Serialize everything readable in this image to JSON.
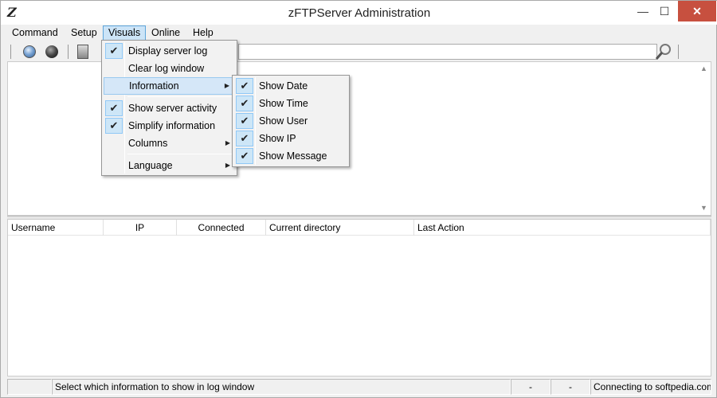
{
  "window": {
    "title": "zFTPServer Administration",
    "app_icon_glyph": "Z"
  },
  "titlebar_buttons": {
    "minimize": "—",
    "maximize": "☐",
    "close": "✕"
  },
  "menubar": {
    "command": "Command",
    "setup": "Setup",
    "visuals": "Visuals",
    "online": "Online",
    "help": "Help"
  },
  "toolbar": {
    "search_icon": "magnifier-icon"
  },
  "visuals_menu": {
    "display_server_log": "Display server log",
    "clear_log_window": "Clear log window",
    "information": "Information",
    "show_server_activity": "Show server activity",
    "simplify_information": "Simplify information",
    "columns": "Columns",
    "language": "Language",
    "checked": {
      "display_server_log": true,
      "show_server_activity": true,
      "simplify_information": true
    }
  },
  "information_submenu": {
    "items": [
      "Show Date",
      "Show Time",
      "Show User",
      "Show IP",
      "Show Message"
    ],
    "all_checked": true
  },
  "users_table": {
    "columns": [
      "Username",
      "IP",
      "Connected",
      "Current directory",
      "Last Action"
    ]
  },
  "statusbar": {
    "cell1": "",
    "message": "Select which information to show in log window",
    "cell3": "-",
    "cell4": "-",
    "connection": "Connecting to softpedia.com"
  },
  "colors": {
    "accent_highlight": "#cce4f7",
    "close_button": "#c7503f"
  }
}
